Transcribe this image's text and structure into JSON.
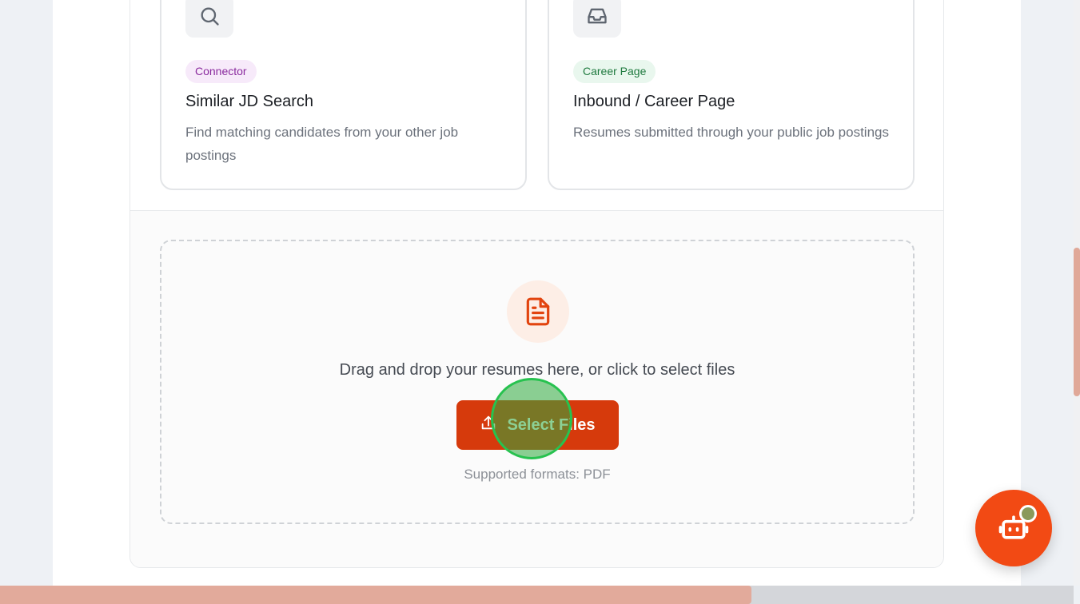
{
  "sources": [
    {
      "icon": "search-icon",
      "badge": "Connector",
      "title": "Similar JD Search",
      "description": "Find matching candidates from your other job postings"
    },
    {
      "icon": "inbox-icon",
      "badge": "Career Page",
      "title": "Inbound / Career Page",
      "description": "Resumes submitted through your public job postings"
    }
  ],
  "upload": {
    "icon": "file-text-icon",
    "instruction": "Drag and drop your resumes here, or click to select files",
    "button_label": "Select Files",
    "supported_formats": "Supported formats: PDF"
  },
  "assistant": {
    "icon": "robot-icon"
  },
  "colors": {
    "accent": "#d63a0c",
    "fab": "#f24a14",
    "badge_purple": "#8a2a9e",
    "badge_green": "#1f7a3f"
  }
}
